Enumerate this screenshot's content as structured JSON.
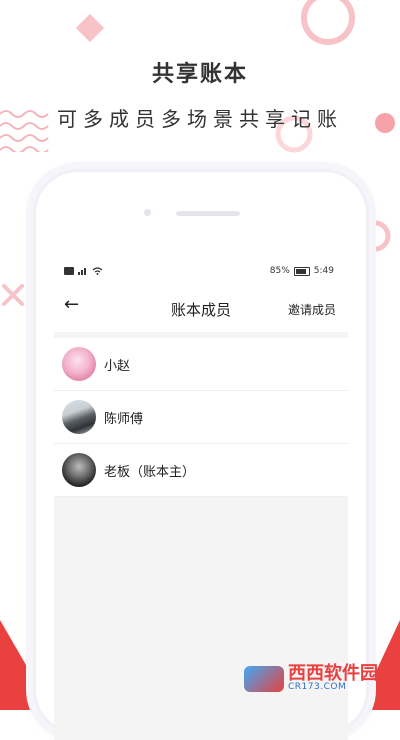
{
  "promo": {
    "title": "共享账本",
    "subtitle": "可多成员多场景共享记账"
  },
  "status_bar": {
    "left_icons": [
      "hd-icon",
      "signal-icon",
      "wifi-icon"
    ],
    "battery": "85%",
    "time": "5:49"
  },
  "app_bar": {
    "back_icon": "←",
    "title": "账本成员",
    "invite_label": "邀请成员"
  },
  "members": [
    {
      "name": "小赵"
    },
    {
      "name": "陈师傅"
    },
    {
      "name": "老板（账本主）"
    }
  ],
  "watermark": {
    "main": "西西软件园",
    "url": "CR173.COM"
  },
  "colors": {
    "accent_red": "#e8413f",
    "pink_decor": "#f7c3c9"
  }
}
